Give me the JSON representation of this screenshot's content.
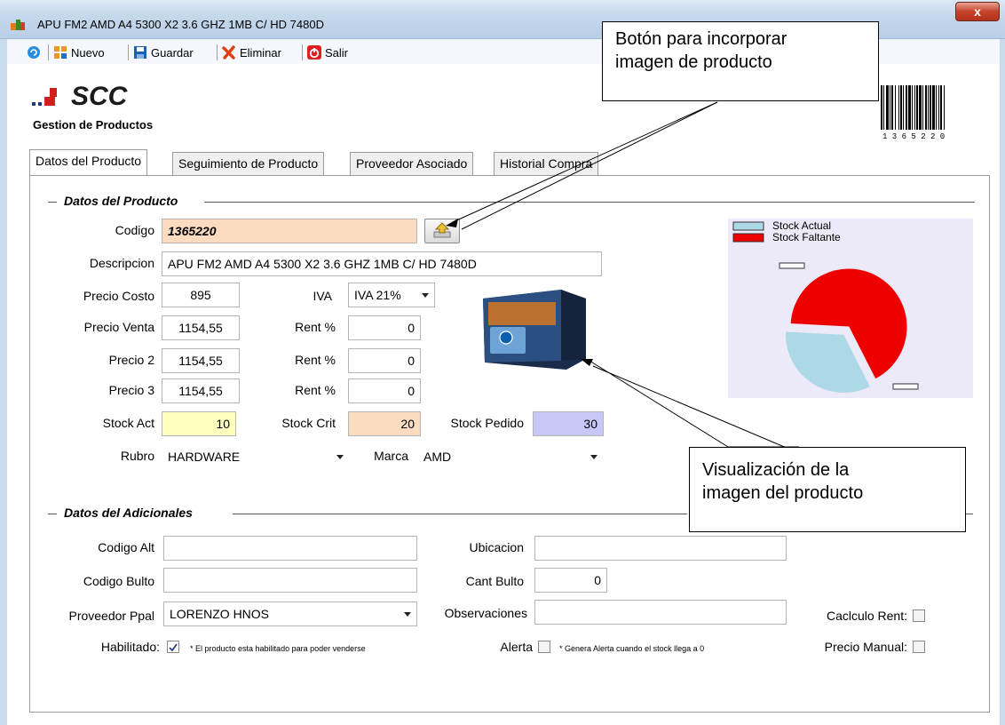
{
  "window": {
    "title": "APU FM2 AMD A4 5300 X2 3.6 GHZ 1MB C/ HD 7480D",
    "close_label": "x"
  },
  "toolbar": {
    "new": "Nuevo",
    "save": "Guardar",
    "delete": "Eliminar",
    "exit": "Salir"
  },
  "brand": {
    "logo": "SCC",
    "subtitle": "Gestion de Productos"
  },
  "barcode": {
    "digits": "1  3  6  5  2  2  0"
  },
  "tabs": [
    "Datos del Producto",
    "Seguimiento de Producto",
    "Proveedor Asociado",
    "Historial Compra"
  ],
  "product": {
    "group_title": "Datos del Producto",
    "codigo_label": "Codigo",
    "codigo": "1365220",
    "descripcion_label": "Descripcion",
    "descripcion": "APU FM2 AMD A4 5300 X2 3.6 GHZ 1MB C/ HD 7480D",
    "precio_costo_label": "Precio Costo",
    "precio_costo": "895",
    "iva_label": "IVA",
    "iva": "IVA 21%",
    "precio_venta_label": "Precio Venta",
    "precio_venta": "1154,55",
    "precio2_label": "Precio 2",
    "precio2": "1154,55",
    "precio3_label": "Precio 3",
    "precio3": "1154,55",
    "rent_label": "Rent %",
    "rent1": "0",
    "rent2": "0",
    "rent3": "0",
    "stock_act_label": "Stock Act",
    "stock_act": "10",
    "stock_crit_label": "Stock Crit",
    "stock_crit": "20",
    "stock_pedido_label": "Stock Pedido",
    "stock_pedido": "30",
    "rubro_label": "Rubro",
    "rubro": "HARDWARE",
    "marca_label": "Marca",
    "marca": "AMD"
  },
  "chart": {
    "legend_actual": "Stock Actual",
    "legend_faltante": "Stock Faltante",
    "color_actual": "#add8e6",
    "color_faltante": "#ee0000"
  },
  "extra": {
    "group_title": "Datos del Adicionales",
    "codigo_alt_label": "Codigo Alt",
    "codigo_alt": "",
    "codigo_bulto_label": "Codigo Bulto",
    "codigo_bulto": "",
    "proveedor_label": "Proveedor Ppal",
    "proveedor": "LORENZO HNOS",
    "ubicacion_label": "Ubicacion",
    "ubicacion": "",
    "cant_bulto_label": "Cant Bulto",
    "cant_bulto": "0",
    "observaciones_label": "Observaciones",
    "observaciones": "",
    "habilitado_label": "Habilitado:",
    "habilitado_note": "* El producto esta habilitado para poder venderse",
    "alerta_label": "Alerta",
    "alerta_note": "* Genera Alerta cuando el stock llega a 0",
    "calculo_rent_label": "Caclculo Rent:",
    "precio_manual_label": "Precio Manual:"
  },
  "callouts": {
    "image_button_line1": "Botón para incorporar",
    "image_button_line2": "imagen de producto",
    "image_view_line1": "Visualización de la",
    "image_view_line2": "imagen del producto"
  },
  "chart_data": {
    "type": "pie",
    "categories": [
      "Stock Actual",
      "Stock Faltante"
    ],
    "values": [
      10,
      20
    ]
  }
}
